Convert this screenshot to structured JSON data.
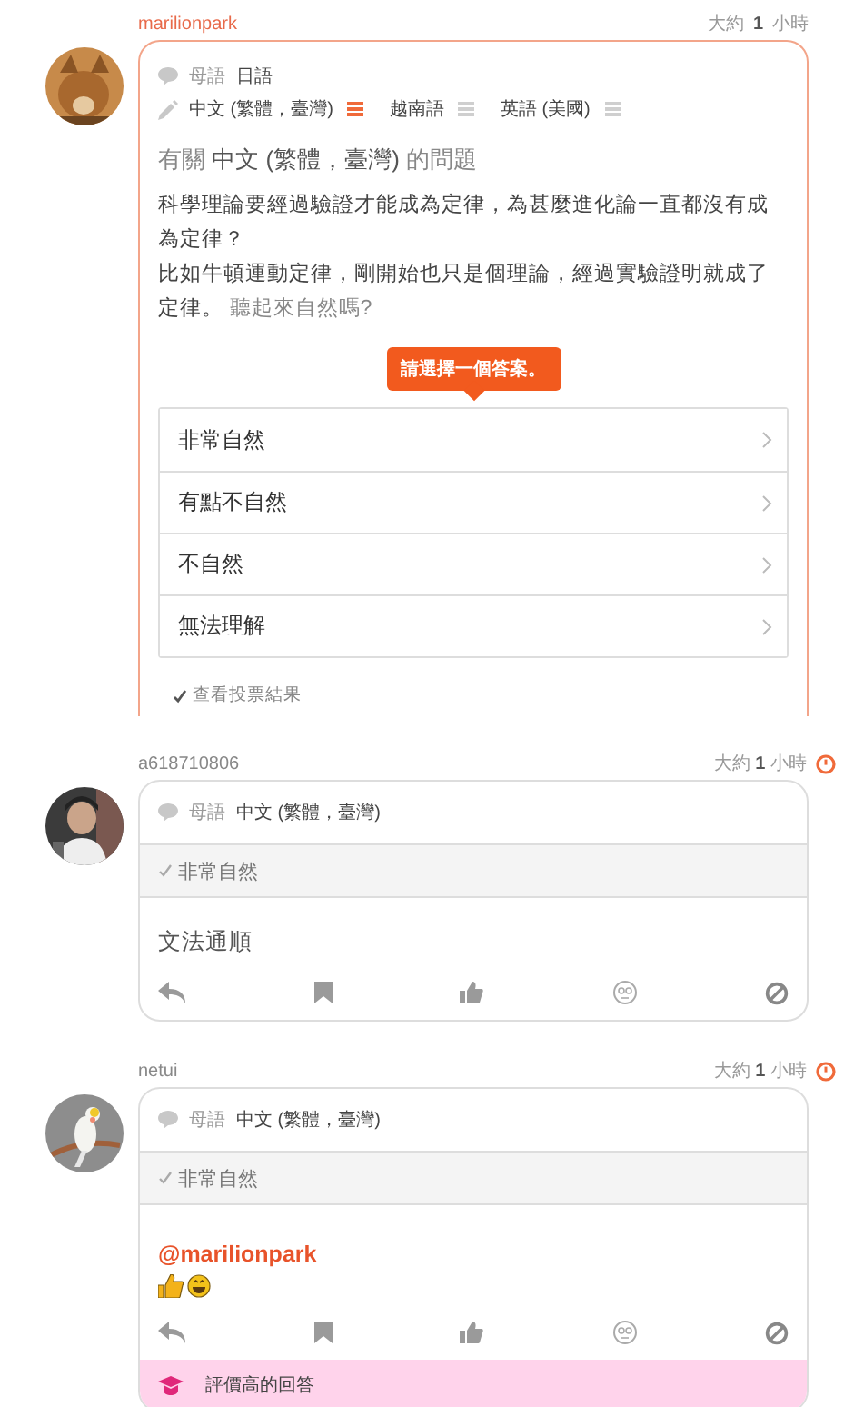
{
  "question": {
    "username": "marilionpark",
    "time": "大約 **1** 小時",
    "native_label": "母語",
    "native_languages": [
      "日語"
    ],
    "learning": [
      {
        "name": "中文 (繁體，臺灣)",
        "advanced": true
      },
      {
        "name": "越南語",
        "advanced": false
      },
      {
        "name": "英語 (美國)",
        "advanced": false
      }
    ],
    "title": "有關 **中文 (繁體，臺灣)** 的問題",
    "body": [
      "科學理論要經過驗證才能成為定律，為甚麼進化論一直都沒有成為定律？",
      "比如牛頓運動定律，剛開始也只是個理論，經過實驗證明就成了定律。"
    ],
    "prompt": "聽起來自然嗎?",
    "tooltip": "請選擇一個答案。",
    "options": [
      "非常自然",
      "有點不自然",
      "不自然",
      "無法理解"
    ],
    "results_link": "查看投票結果"
  },
  "answers": [
    {
      "username": "a618710806",
      "time": "大約 **1** 小時",
      "clock": true,
      "native_label": "母語",
      "native_language": "中文 (繁體，臺灣)",
      "vote": "非常自然",
      "body": "文法通順",
      "emoji": false,
      "highly_rated": false
    },
    {
      "username": "netui",
      "time": "大約 **1** 小時",
      "clock": true,
      "native_label": "母語",
      "native_language": "中文 (繁體，臺灣)",
      "vote": "非常自然",
      "mention": "@marilionpark",
      "emoji": true,
      "highly_rated": true,
      "badge": "評價高的回答"
    }
  ]
}
